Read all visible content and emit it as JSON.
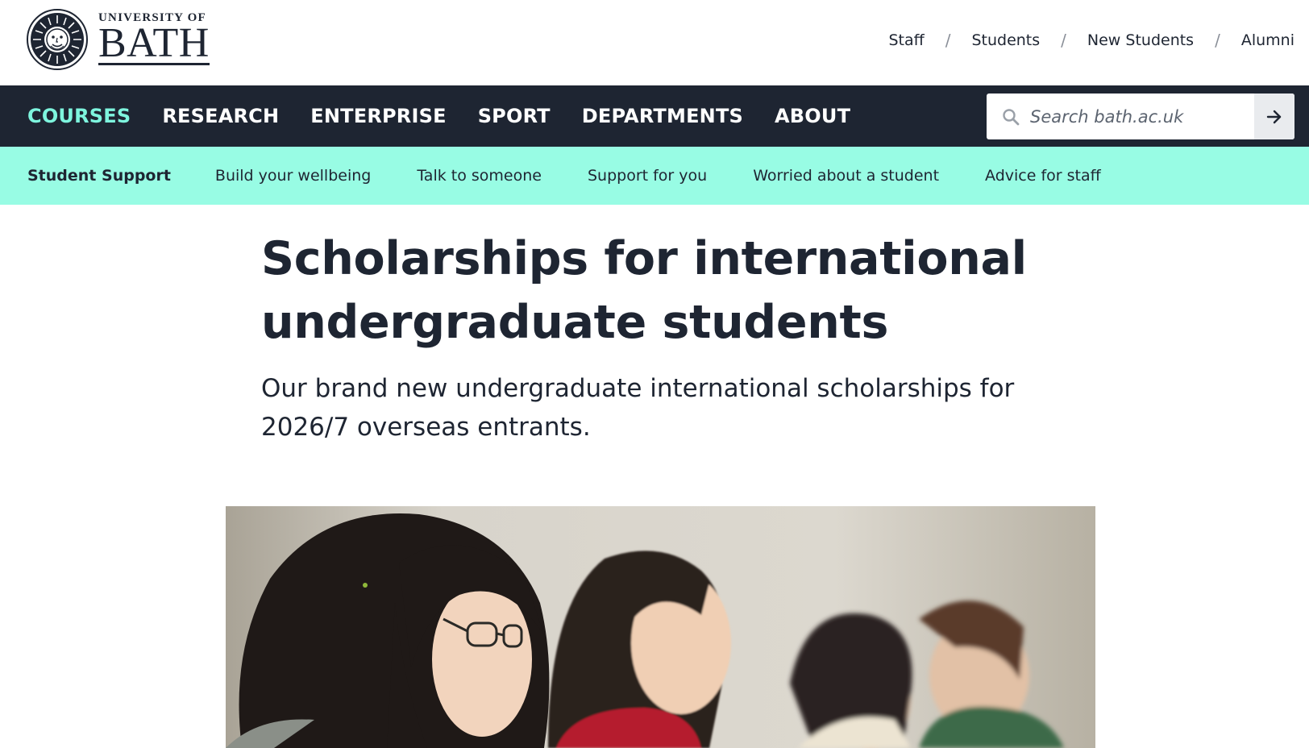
{
  "logo": {
    "line1": "UNIVERSITY OF",
    "line2": "BATH"
  },
  "utility_nav": {
    "items": [
      "Staff",
      "Students",
      "New Students",
      "Alumni"
    ],
    "separator": "/"
  },
  "main_nav": {
    "items": [
      "COURSES",
      "RESEARCH",
      "ENTERPRISE",
      "SPORT",
      "DEPARTMENTS",
      "ABOUT"
    ],
    "active": "COURSES",
    "active_color": "#7ef5de",
    "background": "#1e2532"
  },
  "search": {
    "placeholder": "Search bath.ac.uk",
    "value": "",
    "icon": "search-icon",
    "submit_icon": "arrow-right-icon"
  },
  "sub_nav": {
    "section_title": "Student Support",
    "items": [
      "Build your wellbeing",
      "Talk to someone",
      "Support for you",
      "Worried about a student",
      "Advice for staff"
    ],
    "background": "#98fce4"
  },
  "main": {
    "title": "Scholarships for international undergraduate students",
    "intro": "Our brand new undergraduate international scholarships for 2026/7 overseas entrants."
  }
}
